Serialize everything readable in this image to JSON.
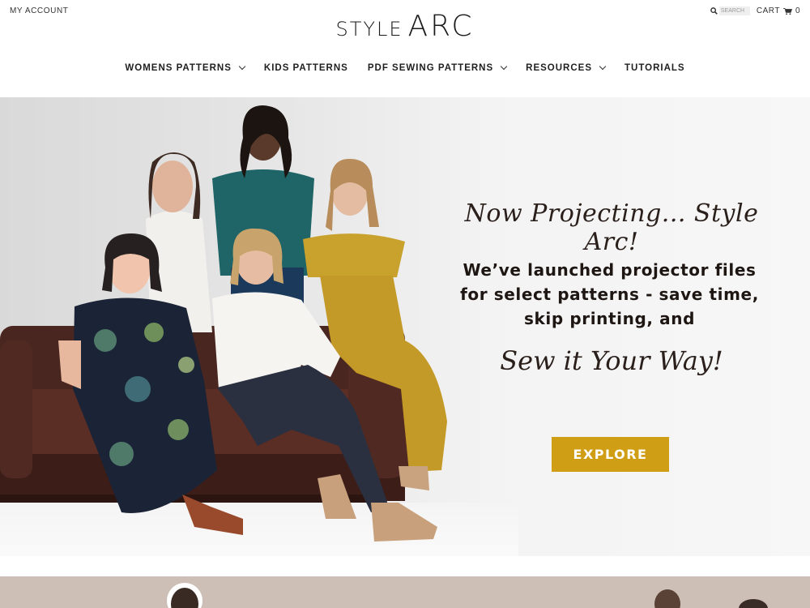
{
  "header": {
    "my_account": "MY ACCOUNT",
    "logo_style": "STYLE",
    "logo_arc": "ARC",
    "search_placeholder": "SEARCH",
    "cart_label": "CART",
    "cart_count": "0"
  },
  "nav": {
    "items": [
      {
        "label": "WOMENS PATTERNS",
        "has_dropdown": true
      },
      {
        "label": "KIDS PATTERNS",
        "has_dropdown": false
      },
      {
        "label": "PDF SEWING PATTERNS",
        "has_dropdown": true
      },
      {
        "label": "RESOURCES",
        "has_dropdown": true
      },
      {
        "label": "TUTORIALS",
        "has_dropdown": false
      }
    ]
  },
  "hero": {
    "headline": "Now Projecting... Style Arc!",
    "body_lines": [
      "We’ve launched projector files",
      "for select patterns - save time,",
      "skip printing, and"
    ],
    "tagline": "Sew it Your Way!",
    "cta_label": "EXPLORE",
    "cta_color": "#d09e14"
  },
  "icons": {
    "search": "search-icon",
    "cart": "cart-icon",
    "dropdown": "chevron-down-icon"
  },
  "colors": {
    "accent": "#d09e14",
    "band": "#cdbfb6"
  }
}
